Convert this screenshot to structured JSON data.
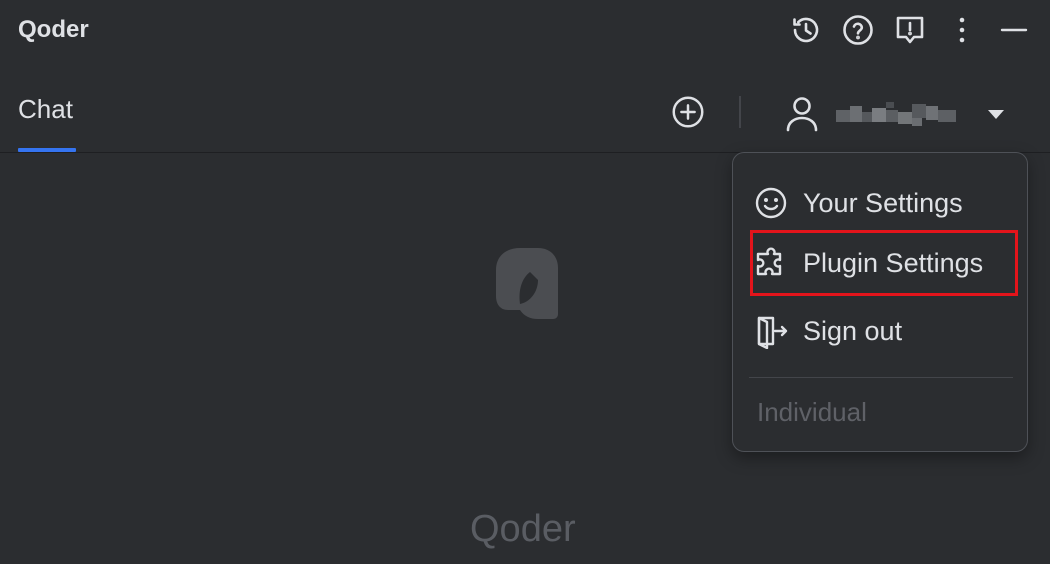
{
  "app": {
    "title": "Qoder"
  },
  "toolbar": {
    "icons": [
      "history-icon",
      "help-icon",
      "feedback-icon",
      "more-icon",
      "minimize-icon"
    ]
  },
  "tabs": [
    {
      "label": "Chat",
      "active": true
    }
  ],
  "header": {
    "new_chat_icon": "plus-circle-icon",
    "user_icon": "user-icon",
    "dropdown_icon": "caret-down-icon"
  },
  "empty_state": {
    "logo_text": "Qoder"
  },
  "menu": {
    "items": [
      {
        "icon": "smiley-icon",
        "label": "Your Settings"
      },
      {
        "icon": "puzzle-icon",
        "label": "Plugin Settings",
        "highlighted": true
      },
      {
        "icon": "sign-out-icon",
        "label": "Sign out"
      }
    ],
    "footer": "Individual"
  },
  "colors": {
    "background": "#2b2d30",
    "text": "#dfe1e5",
    "accent": "#3574f0",
    "highlight_box": "#e3141b",
    "muted": "#5f6167"
  }
}
